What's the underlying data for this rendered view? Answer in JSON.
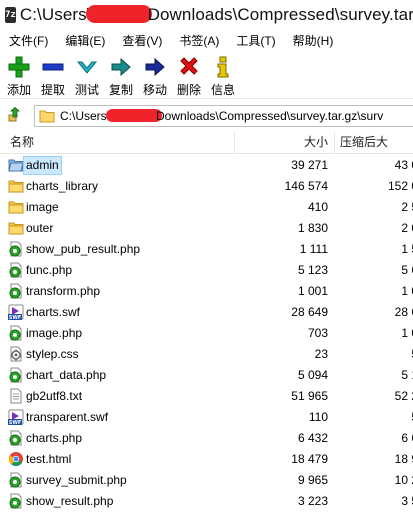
{
  "window": {
    "icon_text": "7z",
    "title_prefix": "C:\\Users\\",
    "title_suffix": "Downloads\\Compressed\\survey.tar"
  },
  "menu": {
    "items": [
      "文件(F)",
      "编辑(E)",
      "查看(V)",
      "书签(A)",
      "工具(T)",
      "帮助(H)"
    ]
  },
  "toolbar": {
    "buttons": [
      {
        "label": "添加",
        "icon": "add-icon",
        "color": "#1aa01a"
      },
      {
        "label": "提取",
        "icon": "extract-icon",
        "color": "#1a3cc8"
      },
      {
        "label": "测试",
        "icon": "test-icon",
        "color": "#1fb5c6"
      },
      {
        "label": "复制",
        "icon": "copy-icon",
        "color": "#1a8a8a"
      },
      {
        "label": "移动",
        "icon": "move-icon",
        "color": "#1a2a9a"
      },
      {
        "label": "删除",
        "icon": "delete-icon",
        "color": "#e01010"
      },
      {
        "label": "信息",
        "icon": "info-icon",
        "color": "#e8c800"
      }
    ]
  },
  "address": {
    "prefix": "C:\\Users\\",
    "suffix": "Downloads\\Compressed\\survey.tar.gz\\surv"
  },
  "columns": {
    "name": "名称",
    "size": "大小",
    "packed": "压缩后大"
  },
  "files": [
    {
      "name": "admin",
      "size": "39 271",
      "packed": "43 0",
      "type": "folder-open",
      "selected": true
    },
    {
      "name": "charts_library",
      "size": "146 574",
      "packed": "152 0",
      "type": "folder"
    },
    {
      "name": "image",
      "size": "410",
      "packed": "2 5",
      "type": "folder"
    },
    {
      "name": "outer",
      "size": "1 830",
      "packed": "2 0",
      "type": "folder"
    },
    {
      "name": "show_pub_result.php",
      "size": "1 111",
      "packed": "1 5",
      "type": "php"
    },
    {
      "name": "func.php",
      "size": "5 123",
      "packed": "5 6",
      "type": "php"
    },
    {
      "name": "transform.php",
      "size": "1 001",
      "packed": "1 0",
      "type": "php"
    },
    {
      "name": "charts.swf",
      "size": "28 649",
      "packed": "28 6",
      "type": "swf"
    },
    {
      "name": "image.php",
      "size": "703",
      "packed": "1 0",
      "type": "php"
    },
    {
      "name": "stylep.css",
      "size": "23",
      "packed": "5",
      "type": "css"
    },
    {
      "name": "chart_data.php",
      "size": "5 094",
      "packed": "5 1",
      "type": "php"
    },
    {
      "name": "gb2utf8.txt",
      "size": "51 965",
      "packed": "52 2",
      "type": "txt"
    },
    {
      "name": "transparent.swf",
      "size": "110",
      "packed": "5",
      "type": "swf"
    },
    {
      "name": "charts.php",
      "size": "6 432",
      "packed": "6 6",
      "type": "php"
    },
    {
      "name": "test.html",
      "size": "18 479",
      "packed": "18 9",
      "type": "html"
    },
    {
      "name": "survey_submit.php",
      "size": "9 965",
      "packed": "10 2",
      "type": "php"
    },
    {
      "name": "show_result.php",
      "size": "3 223",
      "packed": "3 5",
      "type": "php"
    }
  ]
}
